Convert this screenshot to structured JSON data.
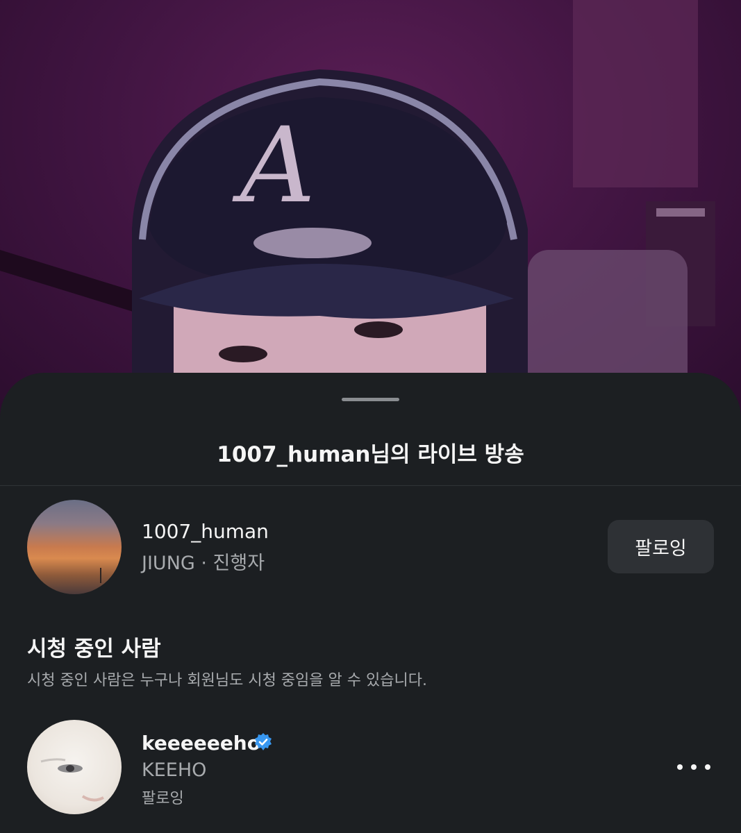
{
  "sheet": {
    "title": "1007_human님의 라이브 방송"
  },
  "host": {
    "username": "1007_human",
    "subtitle": "JIUNG · 진행자",
    "follow_button_label": "팔로잉"
  },
  "viewers_section": {
    "title": "시청 중인 사람",
    "description": "시청 중인 사람은 누구나 회원님도 시청 중임을 알 수 있습니다."
  },
  "viewers": [
    {
      "username": "keeeeeeho",
      "name": "KEEHO",
      "status": "팔로잉",
      "verified": true
    }
  ],
  "colors": {
    "sheet_background": "#1c1f22",
    "verified_badge": "#3897f0",
    "video_tint": "#4a1848"
  }
}
